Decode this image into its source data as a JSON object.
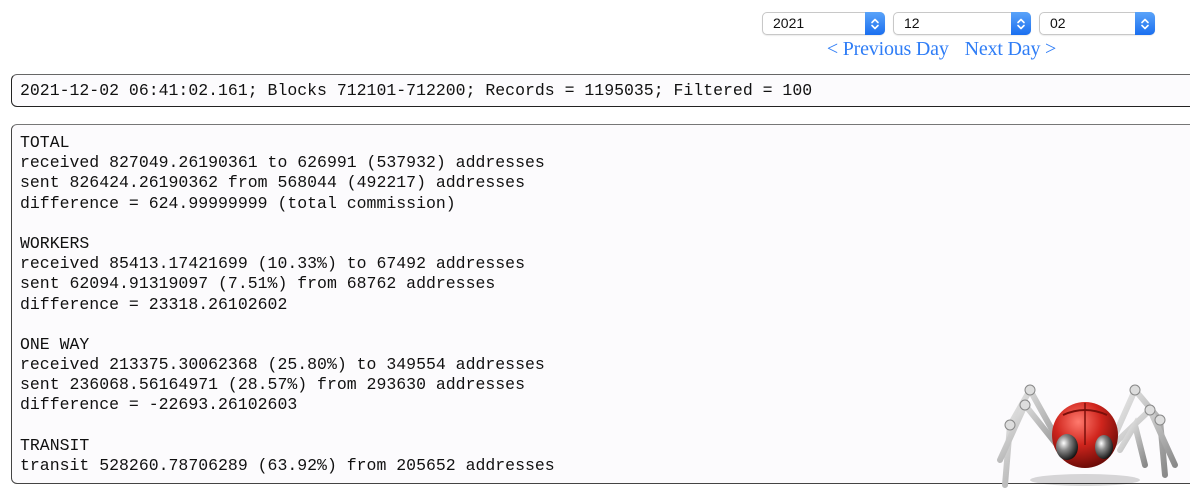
{
  "date_nav": {
    "year": "2021",
    "month": "12",
    "day": "02",
    "previous_day_label": "< Previous Day",
    "next_day_label": "Next Day >"
  },
  "status": {
    "text": "2021-12-02 06:41:02.161; Blocks 712101-712200; Records = 1195035; Filtered = 100"
  },
  "summary": {
    "sections": [
      {
        "title": "TOTAL",
        "lines": [
          "received 827049.26190361 to 626991 (537932) addresses",
          "sent 826424.26190362 from 568044 (492217) addresses",
          "difference = 624.99999999 (total commission)"
        ]
      },
      {
        "title": "WORKERS",
        "lines": [
          "received 85413.17421699 (10.33%) to 67492 addresses",
          "sent 62094.91319097 (7.51%) from 68762 addresses",
          "difference = 23318.26102602"
        ]
      },
      {
        "title": "ONE WAY",
        "lines": [
          "received 213375.30062368 (25.80%) to 349554 addresses",
          "sent 236068.56164971 (28.57%) from 293630 addresses",
          "difference = -22693.26102603"
        ]
      },
      {
        "title": "TRANSIT",
        "lines": [
          "transit 528260.78706289 (63.92%) from 205652 addresses"
        ]
      }
    ]
  },
  "logo": {
    "icon": "robot-spider-icon"
  },
  "colors": {
    "link": "#2f7df6",
    "select_accent": "#1a6ff0",
    "logo_red": "#c8211c"
  }
}
